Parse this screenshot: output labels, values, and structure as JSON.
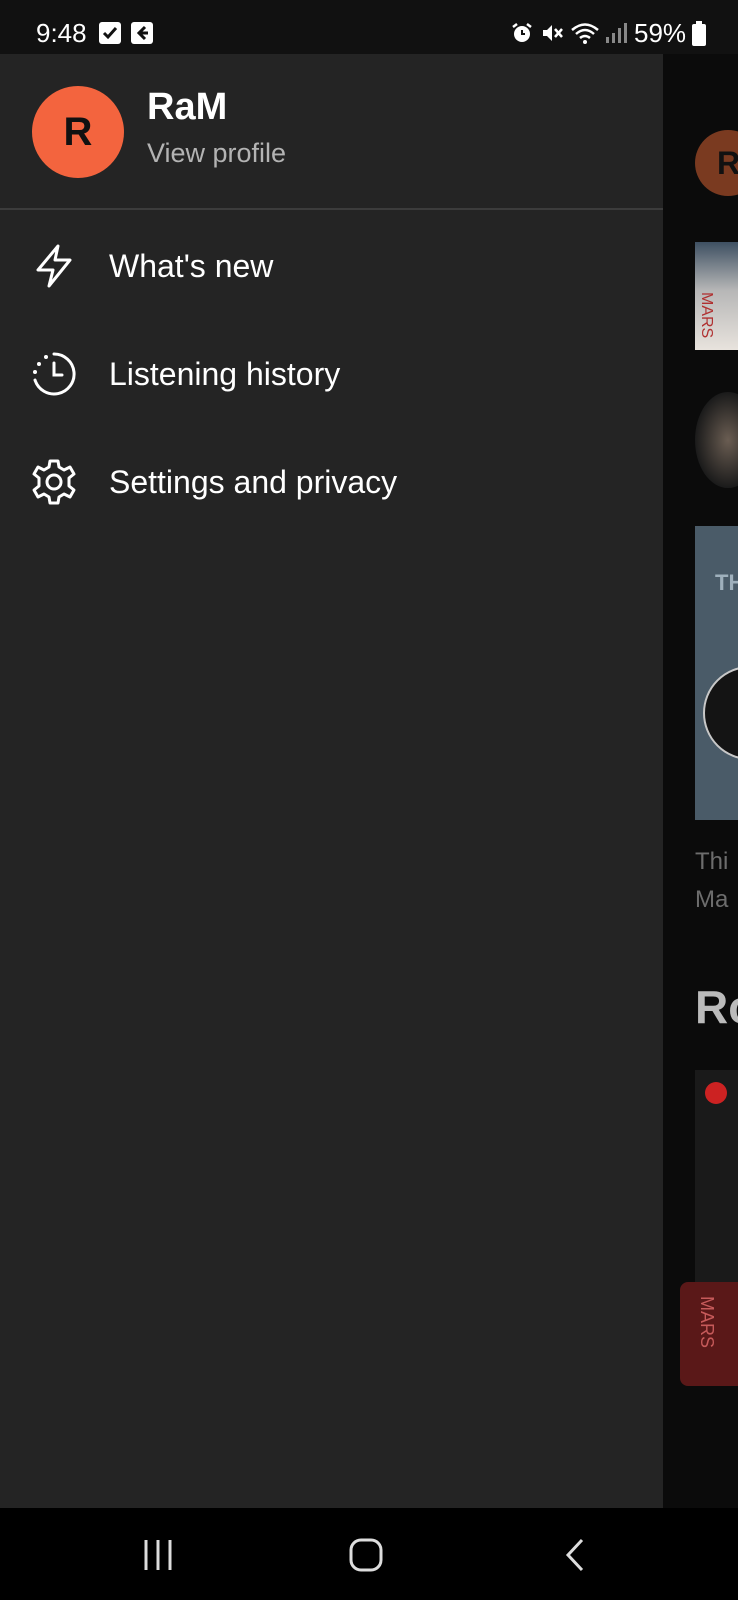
{
  "status_bar": {
    "time": "9:48",
    "battery": "59%",
    "icons": [
      "checkbox-icon",
      "exit-icon",
      "alarm-icon",
      "mute-icon",
      "wifi-icon",
      "signal-icon",
      "battery-icon"
    ]
  },
  "profile": {
    "avatar_letter": "R",
    "avatar_color": "#f3643e",
    "name": "RaM",
    "link": "View profile"
  },
  "menu": {
    "items": [
      {
        "label": "What's new",
        "icon": "bolt-icon"
      },
      {
        "label": "Listening history",
        "icon": "history-icon"
      },
      {
        "label": "Settings and privacy",
        "icon": "gear-icon"
      }
    ]
  },
  "background": {
    "avatar_letter": "R",
    "album_text": "MARS",
    "card_text": "TH",
    "caption_line1": "Thi",
    "caption_line2": "Ma",
    "heading": "Ro",
    "mini_text": "MARS"
  },
  "nav_bar": {
    "buttons": [
      "recents-button",
      "home-button",
      "back-button"
    ]
  },
  "colors": {
    "drawer_bg": "#242424",
    "app_bg": "#0c0c0c",
    "accent": "#f3643e"
  }
}
